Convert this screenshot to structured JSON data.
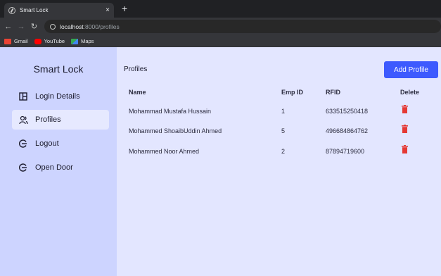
{
  "browser": {
    "tab_title": "Smart Lock",
    "tab_close": "×",
    "new_tab": "+",
    "url_host": "localhost",
    "url_path": ":8000/profiles",
    "bookmarks": [
      {
        "label": "Gmail",
        "icon": "gmail-icon",
        "color": "#ea4335"
      },
      {
        "label": "YouTube",
        "icon": "youtube-icon",
        "color": "#ff0000"
      },
      {
        "label": "Maps",
        "icon": "maps-icon",
        "color": "#34a853"
      }
    ]
  },
  "sidebar": {
    "brand": "Smart Lock",
    "items": [
      {
        "label": "Login Details",
        "icon": "table-icon",
        "active": false
      },
      {
        "label": "Profiles",
        "icon": "users-icon",
        "active": true
      },
      {
        "label": "Logout",
        "icon": "logout-icon",
        "active": false
      },
      {
        "label": "Open Door",
        "icon": "door-icon",
        "active": false
      }
    ]
  },
  "main": {
    "title": "Profiles",
    "add_button": "Add Profile",
    "columns": [
      "Name",
      "Emp ID",
      "RFID",
      "Delete"
    ],
    "rows": [
      {
        "name": "Mohammad Mustafa Hussain",
        "emp_id": "1",
        "rfid": "633515250418"
      },
      {
        "name": "Mohammed ShoaibUddin Ahmed",
        "emp_id": "5",
        "rfid": "496684864762"
      },
      {
        "name": "Mohammed Noor Ahmed",
        "emp_id": "2",
        "rfid": "87894719600"
      }
    ]
  },
  "colors": {
    "accent": "#3d5afe",
    "delete": "#e53935",
    "sidebar_bg": "#cdd4ff",
    "main_bg": "#e3e6ff"
  }
}
